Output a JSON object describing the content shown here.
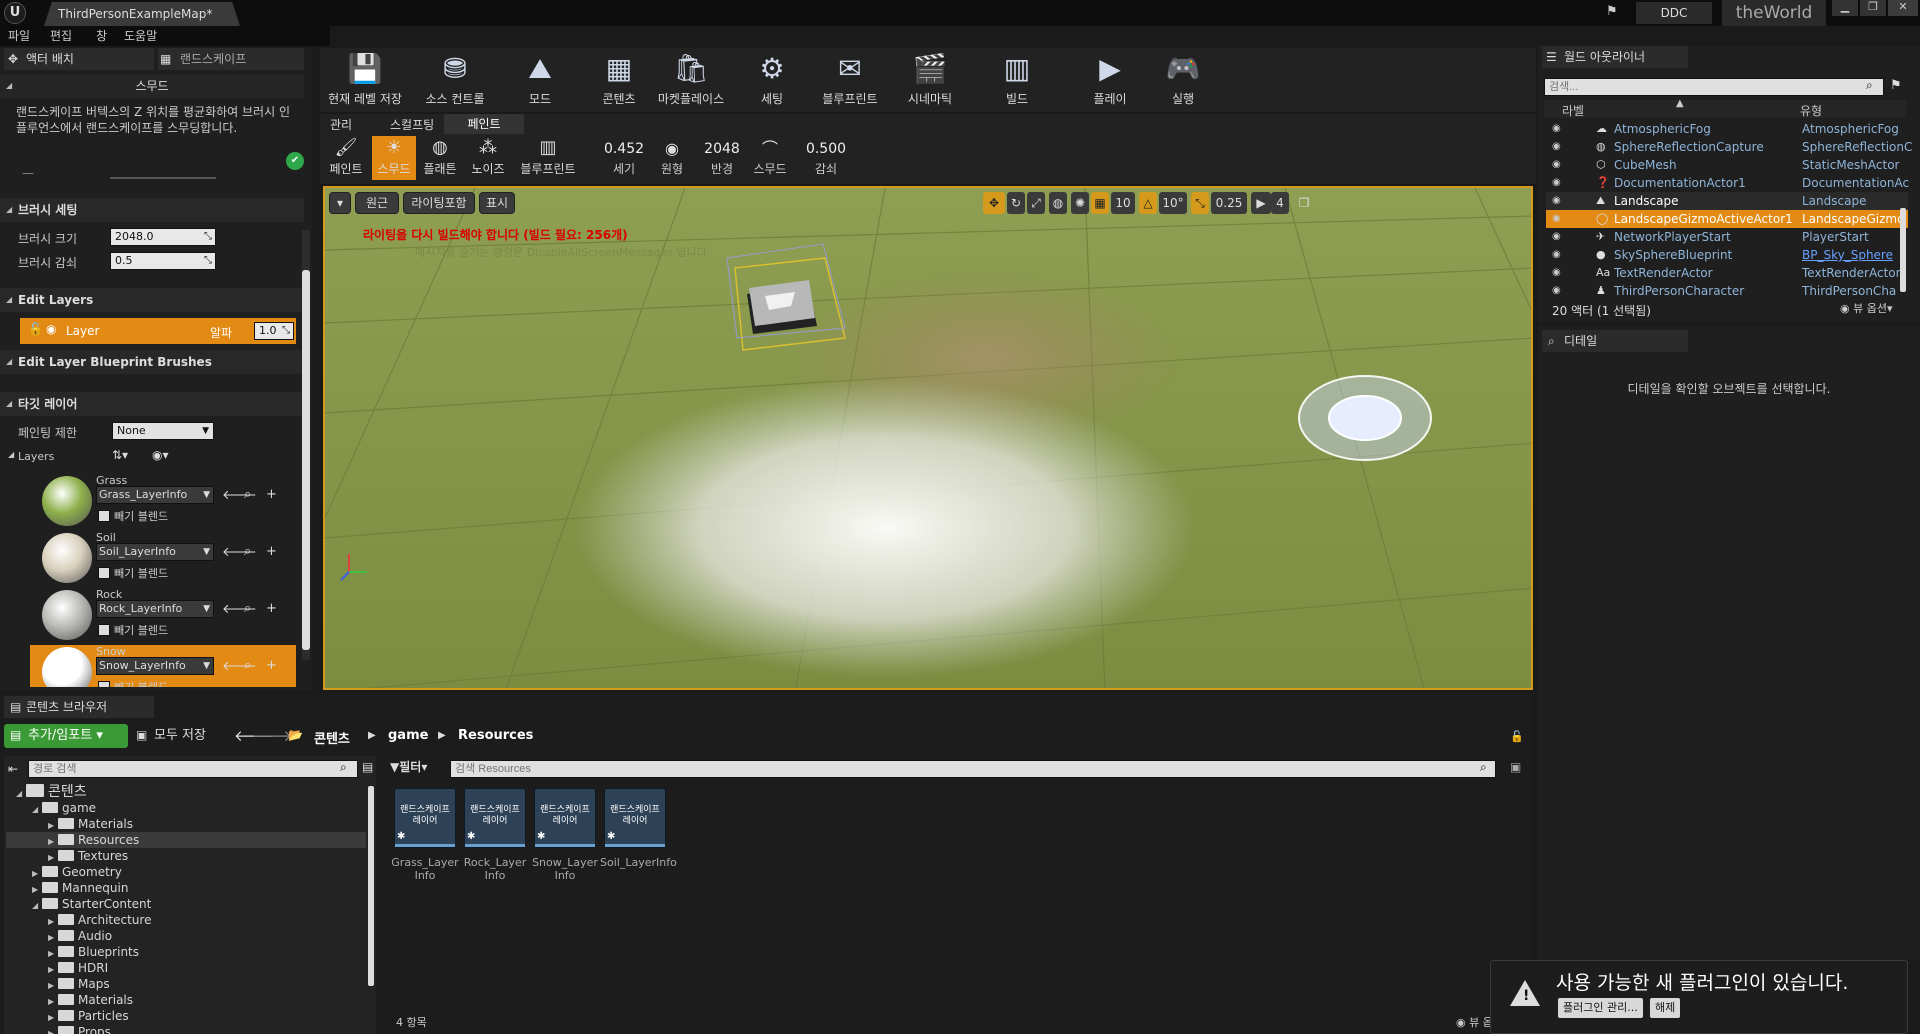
{
  "titlebar": {
    "logo": "U",
    "doc_tab": "ThirdPersonExampleMap*",
    "ddc": "DDC",
    "world": "theWorld",
    "min": "▁",
    "max": "❐",
    "close": "✕"
  },
  "menu": [
    "파일",
    "편집",
    "창",
    "도움말"
  ],
  "left_tabs": {
    "actor_placement": "액터 배치",
    "landscape": "랜드스케이프"
  },
  "tool": {
    "header": "스무드",
    "description": "랜드스케이프 버텍스의 Z 위치를 평균화하여 브러시 인플루언스에서 랜드스케이프를 스무딩합니다.",
    "dash": "—"
  },
  "brush": {
    "section": "브러시 세팅",
    "size_label": "브러시 크기",
    "size_value": "2048.0",
    "falloff_label": "브러시 감쇠",
    "falloff_value": "0.5"
  },
  "edit_layers": {
    "section": "Edit Layers",
    "layer_name": "Layer",
    "alpha_label": "알파",
    "alpha_value": "1.0"
  },
  "bp_brushes": {
    "section": "Edit Layer Blueprint Brushes"
  },
  "target": {
    "section": "타깃 레이어",
    "paint_limit_label": "페인팅 제한",
    "paint_limit_value": "None",
    "layers_label": "Layers"
  },
  "layers": [
    {
      "name": "Grass",
      "info": "Grass_LayerInfo",
      "blend": "빼기 블렌드",
      "color": "#8db04a"
    },
    {
      "name": "Soil",
      "info": "Soil_LayerInfo",
      "blend": "빼기 블렌드",
      "color": "#d8d0bc"
    },
    {
      "name": "Rock",
      "info": "Rock_LayerInfo",
      "blend": "빼기 블렌드",
      "color": "#b8bab4"
    },
    {
      "name": "Snow",
      "info": "Snow_LayerInfo",
      "blend": "빼기 블렌드",
      "color": "#ffffff"
    }
  ],
  "toolbar": [
    {
      "label": "현재 레벨 저장",
      "icon": "save-icon"
    },
    {
      "label": "소스 컨트롤",
      "icon": "source-control-icon"
    },
    {
      "label": "모드",
      "icon": "modes-icon"
    },
    {
      "label": "콘텐츠",
      "icon": "content-icon"
    },
    {
      "label": "마켓플레이스",
      "icon": "marketplace-icon"
    },
    {
      "label": "세팅",
      "icon": "settings-icon"
    },
    {
      "label": "블루프린트",
      "icon": "blueprint-icon"
    },
    {
      "label": "시네마틱",
      "icon": "cinematic-icon"
    },
    {
      "label": "빌드",
      "icon": "build-icon"
    },
    {
      "label": "플레이",
      "icon": "play-icon"
    },
    {
      "label": "실행",
      "icon": "launch-icon"
    }
  ],
  "mode_tabs": [
    "관리",
    "스컬프팅",
    "페인트"
  ],
  "tools": [
    {
      "label": "페인트",
      "icon": "paint-brush-icon"
    },
    {
      "label": "스무드",
      "icon": "smooth-icon"
    },
    {
      "label": "플래튼",
      "icon": "flatten-icon"
    },
    {
      "label": "노이즈",
      "icon": "noise-icon"
    },
    {
      "label": "블루프린트",
      "icon": "blueprint-tool-icon"
    }
  ],
  "brush_opts": [
    {
      "value": "0.452",
      "label": "세기"
    },
    {
      "value": "",
      "label": "원형"
    },
    {
      "value": "2048",
      "label": "반경"
    },
    {
      "value": "",
      "label": "스무드"
    },
    {
      "value": "0.500",
      "label": "감쇠"
    }
  ],
  "viewport": {
    "perspective": "원근",
    "lit": "라이팅포함",
    "show": "표시",
    "warning": "라이팅을 다시 빌드해야 합니다 (빌드 필요: 256개)",
    "hint": "메시지를 숨기는 명령은 DisableAllScreenMessages 입니다.",
    "grid": "10",
    "angle": "10°",
    "scale": "0.25",
    "cam": "4"
  },
  "outliner": {
    "tab": "월드 아웃라이너",
    "search_placeholder": "검색...",
    "col_label": "라벨",
    "col_type": "유형",
    "rows": [
      {
        "name": "AtmosphericFog",
        "type": "AtmosphericFog"
      },
      {
        "name": "SphereReflectionCapture",
        "type": "SphereReflectionC"
      },
      {
        "name": "CubeMesh",
        "type": "StaticMeshActor"
      },
      {
        "name": "DocumentationActor1",
        "type": "DocumentationAc"
      },
      {
        "name": "Landscape",
        "type": "Landscape"
      },
      {
        "name": "LandscapeGizmoActiveActor1",
        "type": "LandscapeGizmo"
      },
      {
        "name": "NetworkPlayerStart",
        "type": "PlayerStart"
      },
      {
        "name": "SkySphereBlueprint",
        "type": "BP_Sky_Sphere"
      },
      {
        "name": "TextRenderActor",
        "type": "TextRenderActor"
      },
      {
        "name": "ThirdPersonCharacter",
        "type": "ThirdPersonCha"
      }
    ],
    "footer": "20 액터 (1 선택됨)",
    "view_options": "뷰 옵션"
  },
  "details": {
    "tab": "디테일",
    "empty": "디테일을 확인할 오브젝트를 선택합니다."
  },
  "content": {
    "tab": "콘텐츠 브라우저",
    "add_import": "추가/임포트",
    "save_all": "모두 저장",
    "crumbs": [
      "콘텐츠",
      "game",
      "Resources"
    ],
    "path_search": "경로 검색",
    "filter": "필터",
    "asset_search": "검색 Resources",
    "tree": [
      {
        "label": "콘텐츠",
        "depth": 0,
        "open": true
      },
      {
        "label": "game",
        "depth": 1,
        "open": true
      },
      {
        "label": "Materials",
        "depth": 2
      },
      {
        "label": "Resources",
        "depth": 2,
        "selected": true
      },
      {
        "label": "Textures",
        "depth": 2
      },
      {
        "label": "Geometry",
        "depth": 1
      },
      {
        "label": "Mannequin",
        "depth": 1
      },
      {
        "label": "StarterContent",
        "depth": 1,
        "open": true
      },
      {
        "label": "Architecture",
        "depth": 2
      },
      {
        "label": "Audio",
        "depth": 2
      },
      {
        "label": "Blueprints",
        "depth": 2
      },
      {
        "label": "HDRI",
        "depth": 2
      },
      {
        "label": "Maps",
        "depth": 2
      },
      {
        "label": "Materials",
        "depth": 2
      },
      {
        "label": "Particles",
        "depth": 2
      },
      {
        "label": "Props",
        "depth": 2
      }
    ],
    "assets": [
      {
        "thumb": "랜드스케이프 레이어",
        "name": "Grass_Layer Info"
      },
      {
        "thumb": "랜드스케이프 레이어",
        "name": "Rock_Layer Info"
      },
      {
        "thumb": "랜드스케이프 레이어",
        "name": "Snow_Layer Info"
      },
      {
        "thumb": "랜드스케이프 레이어",
        "name": "Soil_LayerInfo"
      }
    ],
    "count": "4 항목",
    "view_options": "뷰 옵션"
  },
  "toast": {
    "title": "사용 가능한 새 플러그인이 있습니다.",
    "manage": "플러그인 관리...",
    "dismiss": "해제"
  }
}
